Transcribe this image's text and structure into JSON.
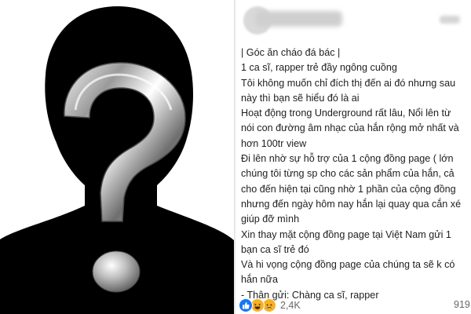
{
  "post": {
    "lines": [
      "| Góc ăn cháo đá bác |",
      "1 ca sĩ, rapper trẻ đầy ngông cuồng",
      "Tôi không muốn chỉ đích thị đến ai đó nhưng sau",
      "này thì bạn sẽ hiểu đó là ai",
      "Hoạt động trong Underground rất lâu, Nổi lên từ",
      "nói con đường âm nhạc của hắn rộng mở nhất và",
      "hơn 100tr view",
      "Đi lên nhờ sự hỗ trợ của 1 cộng đồng page ( lớn",
      "chúng tôi từng sp cho các sản phẩm của hắn, cả",
      "cho đến hiện tại cũng nhờ 1 phần của cộng đồng",
      "nhưng đến ngày hôm nay hắn lại quay qua cắn xé",
      "giúp đỡ mình",
      "Xin thay mặt cộng đồng page tại Việt Nam gửi 1",
      "bạn ca sĩ trẻ đó",
      "Và hi vọng cộng đồng page của chúng ta sẽ k có",
      "hắn nữa",
      "- Thân gửi: Chàng ca sĩ, rapper"
    ]
  },
  "reactions": {
    "icons": [
      "like-icon",
      "haha-icon",
      "sad-icon"
    ],
    "count": "2,4K",
    "comments": "919"
  },
  "colors": {
    "silhouette": "#000000",
    "text": "#1c1e21",
    "meta": "#65676b",
    "like": "#1877f2"
  }
}
